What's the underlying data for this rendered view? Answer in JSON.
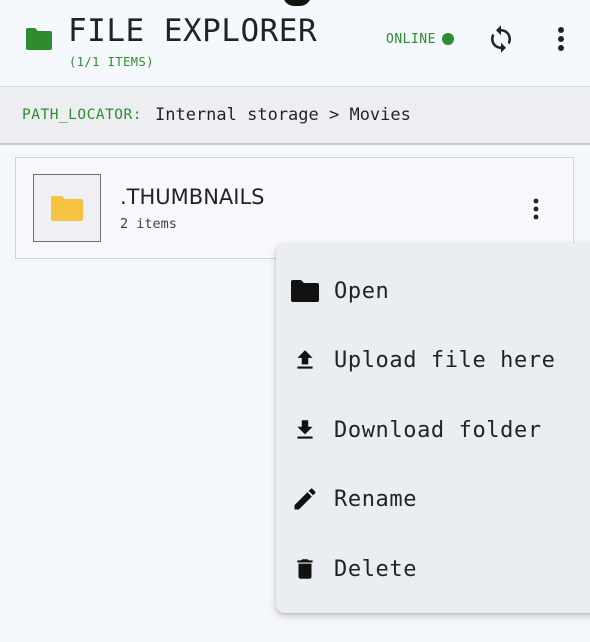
{
  "header": {
    "title": "FILE EXPLORER",
    "subtitle": "(1/1 ITEMS)",
    "status_text": "ONLINE",
    "status_color": "#2e8b2e",
    "icons": {
      "app": "folder-icon",
      "sync": "sync-icon",
      "more": "more-vert-icon"
    }
  },
  "pathbar": {
    "label": "PATH_LOCATOR:",
    "value": "Internal storage > Movies"
  },
  "items": [
    {
      "name": ".THUMBNAILS",
      "count": "2 items",
      "icon": "folder-icon",
      "icon_color": "#f5c342"
    }
  ],
  "context_menu": {
    "items": [
      {
        "label": "Open",
        "icon": "folder-icon"
      },
      {
        "label": "Upload file here",
        "icon": "upload-icon"
      },
      {
        "label": "Download folder",
        "icon": "download-icon"
      },
      {
        "label": "Rename",
        "icon": "pencil-icon"
      },
      {
        "label": "Delete",
        "icon": "trash-icon"
      }
    ]
  },
  "colors": {
    "accent": "#2e8b2e",
    "folder": "#f5c342",
    "menu_bg": "#eaedf1"
  }
}
